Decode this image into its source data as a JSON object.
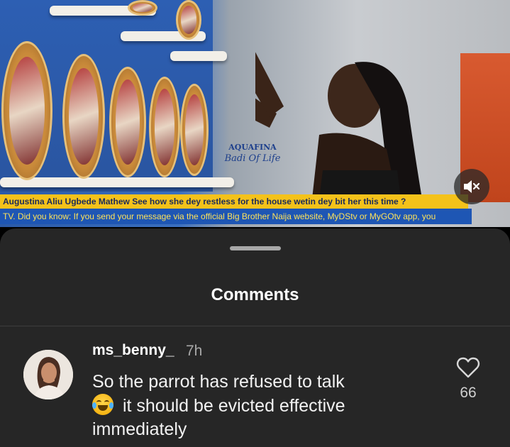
{
  "video": {
    "ticker_headline": "Augustina Aliu Ugbede Mathew  See how she dey restless for the house wetin dey bit her this time ?",
    "ticker_info": "TV. Did you know: If you send your message via the official Big Brother Naija website, MyDStv or MyGOtv app, you",
    "sign_brand": "AQUAFINA",
    "sign_tagline": "Badi Of Life",
    "mute_icon": "speaker-muted-icon"
  },
  "sheet": {
    "title": "Comments"
  },
  "comment": {
    "username": "ms_benny_",
    "time": "7h",
    "line1": "So the parrot has refused to talk",
    "line2": " it should be evicted effective",
    "line3": "immediately",
    "emoji_icon": "face-with-tears-of-joy-emoji",
    "like_count": "66",
    "like_icon": "heart-outline-icon"
  },
  "colors": {
    "sheet_bg": "#262626",
    "ticker_yellow": "#f4c21a",
    "ticker_blue": "#1e56b4",
    "muted_text": "#a8a8a8"
  }
}
